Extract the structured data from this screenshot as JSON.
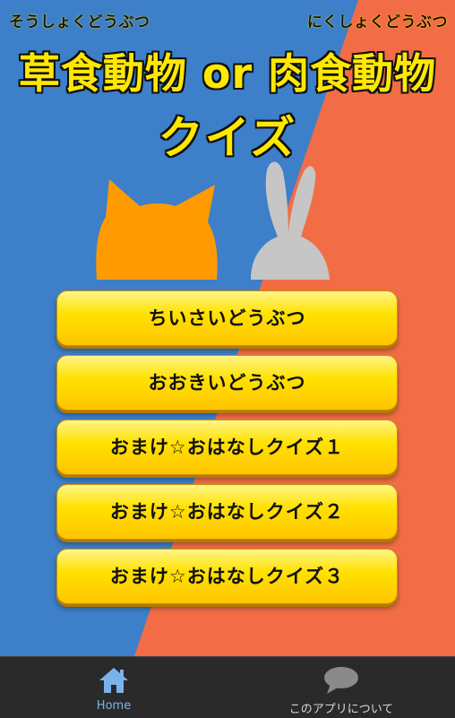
{
  "colors": {
    "left_bg": "#3d7fc9",
    "right_bg": "#f26d45",
    "title_yellow": "#ffe800",
    "button_yellow": "#ffe100",
    "tabbar": "#2a2a2a",
    "tab_active": "#7ab3ea",
    "cat": "#ff9b00",
    "rabbit": "#c6c6c6"
  },
  "header": {
    "ruby_left": "そうしょくどうぶつ",
    "ruby_right": "にくしょくどうぶつ",
    "title_line1": "草食動物 or 肉食動物",
    "title_line2": "クイズ"
  },
  "illustrations": {
    "left": "cat-silhouette-icon",
    "right": "rabbit-silhouette-icon"
  },
  "menu": {
    "items": [
      {
        "label": "ちいさいどうぶつ"
      },
      {
        "label": "おおきいどうぶつ"
      },
      {
        "label": "おまけ☆おはなしクイズ１"
      },
      {
        "label": "おまけ☆おはなしクイズ２"
      },
      {
        "label": "おまけ☆おはなしクイズ３"
      }
    ]
  },
  "tabbar": {
    "home": {
      "label": "Home",
      "icon": "home-icon",
      "active": true
    },
    "about": {
      "label": "このアプリについて",
      "icon": "speech-bubble-icon",
      "active": false
    }
  }
}
